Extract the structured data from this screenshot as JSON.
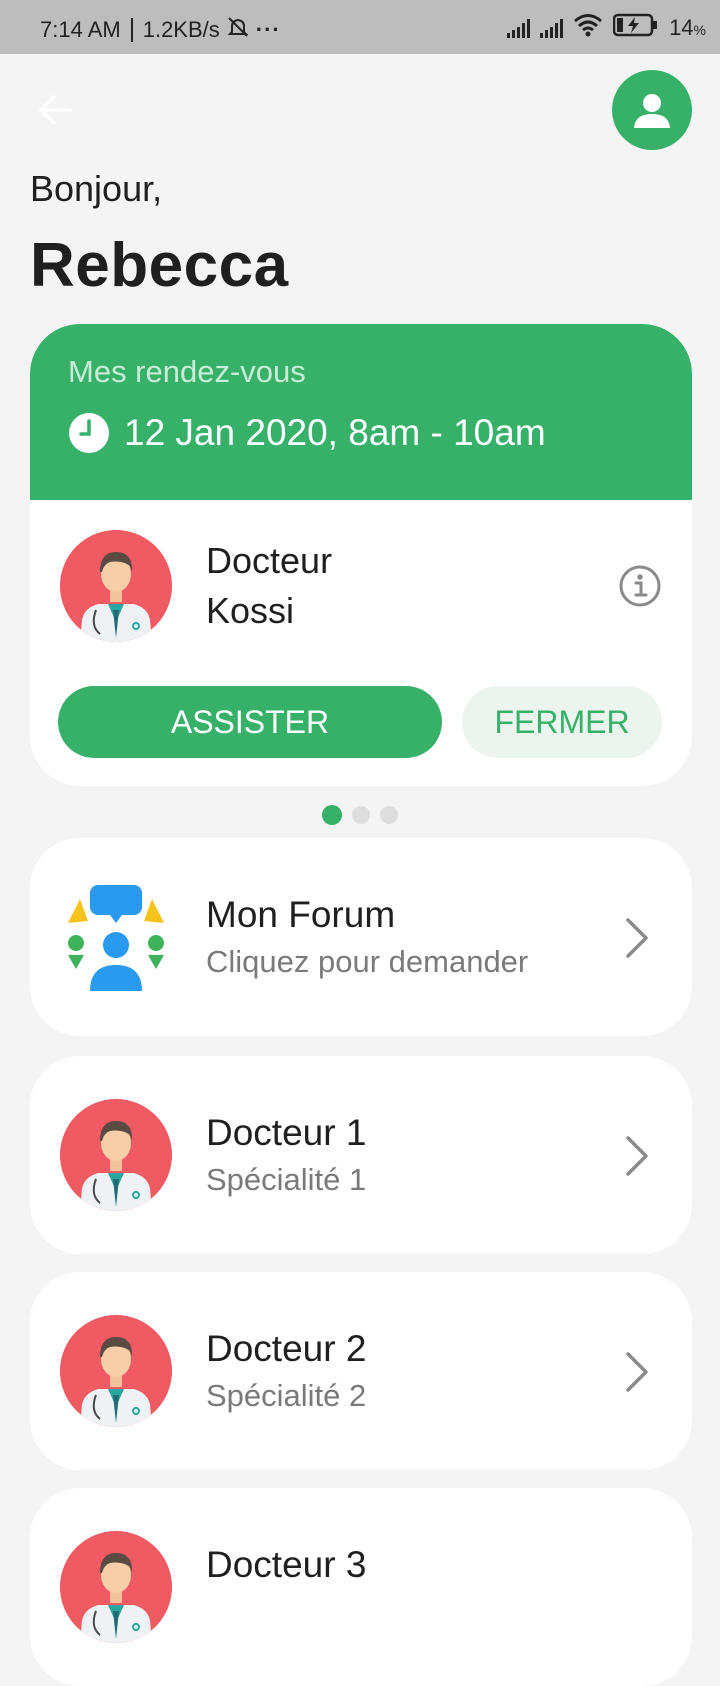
{
  "status_bar": {
    "time": "7:14 AM",
    "speed": "1.2KB/s",
    "more": "···",
    "battery": "14",
    "battery_unit": "%"
  },
  "header": {
    "greeting": "Bonjour,",
    "user_name": "Rebecca"
  },
  "appointment": {
    "title": "Mes rendez-vous",
    "datetime": "12 Jan 2020, 8am - 10am",
    "doctor_line1": "Docteur",
    "doctor_line2": "Kossi",
    "assist_label": "ASSISTER",
    "close_label": "FERMER"
  },
  "carousel": {
    "pages": 3,
    "active": 1
  },
  "list": [
    {
      "title": "Mon Forum",
      "subtitle": "Cliquez pour demander"
    },
    {
      "title": "Docteur 1",
      "subtitle": "Spécialité 1"
    },
    {
      "title": "Docteur 2",
      "subtitle": "Spécialité 2"
    },
    {
      "title": "Docteur 3",
      "subtitle": ""
    }
  ],
  "colors": {
    "accent": "#37b16a",
    "avatar_bg": "#f05a62",
    "status_bar_bg": "#bdbdbd",
    "page_bg": "#f4f4f4"
  }
}
